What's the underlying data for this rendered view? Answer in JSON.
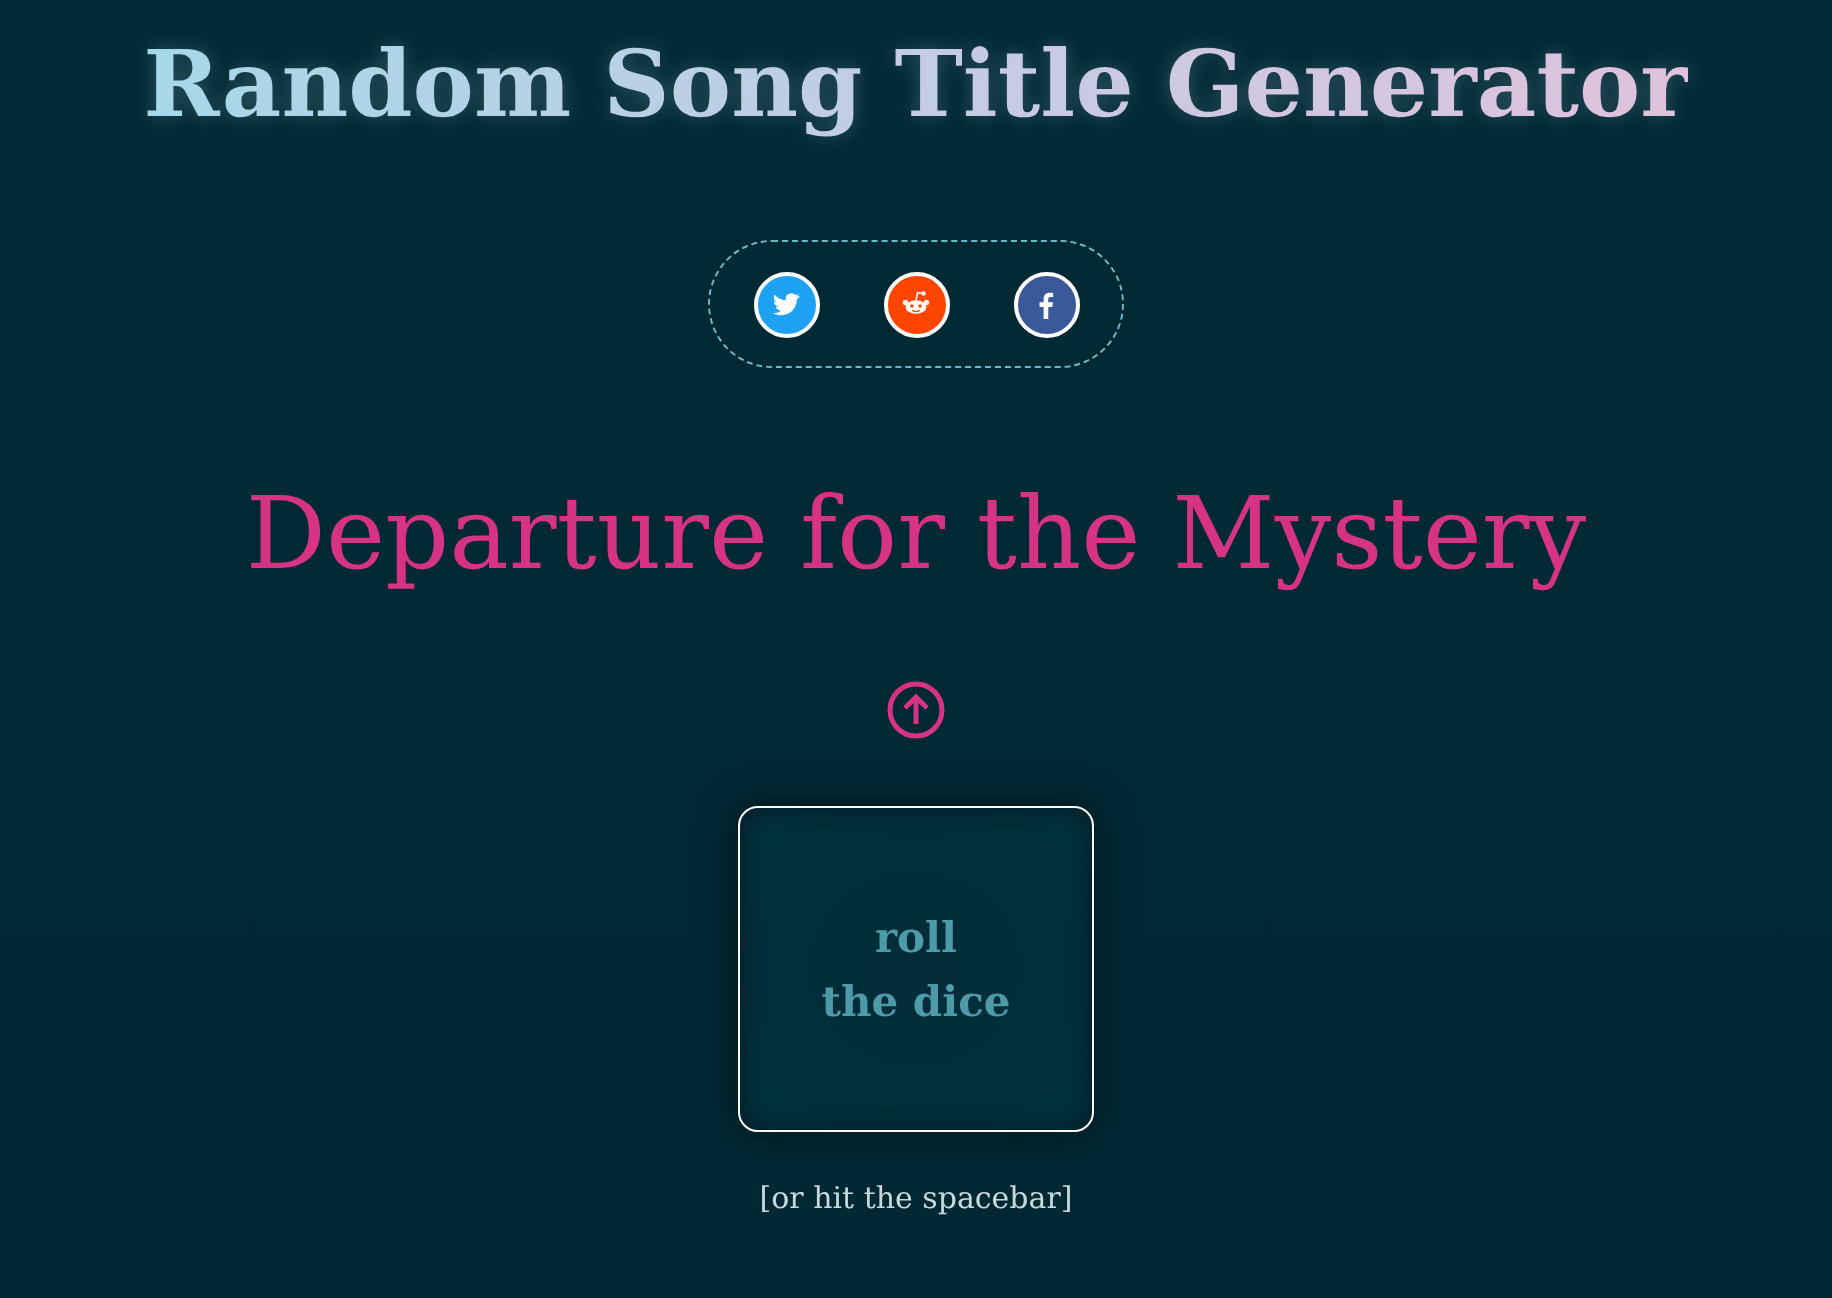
{
  "title": "Random Song Title Generator",
  "share": [
    {
      "kind": "twitter"
    },
    {
      "kind": "reddit"
    },
    {
      "kind": "facebook"
    }
  ],
  "song_title": "Departure for the Mystery",
  "roll_button": {
    "line_1": "roll",
    "line_2": "the dice"
  },
  "hint": "[or hit the spacebar]"
}
